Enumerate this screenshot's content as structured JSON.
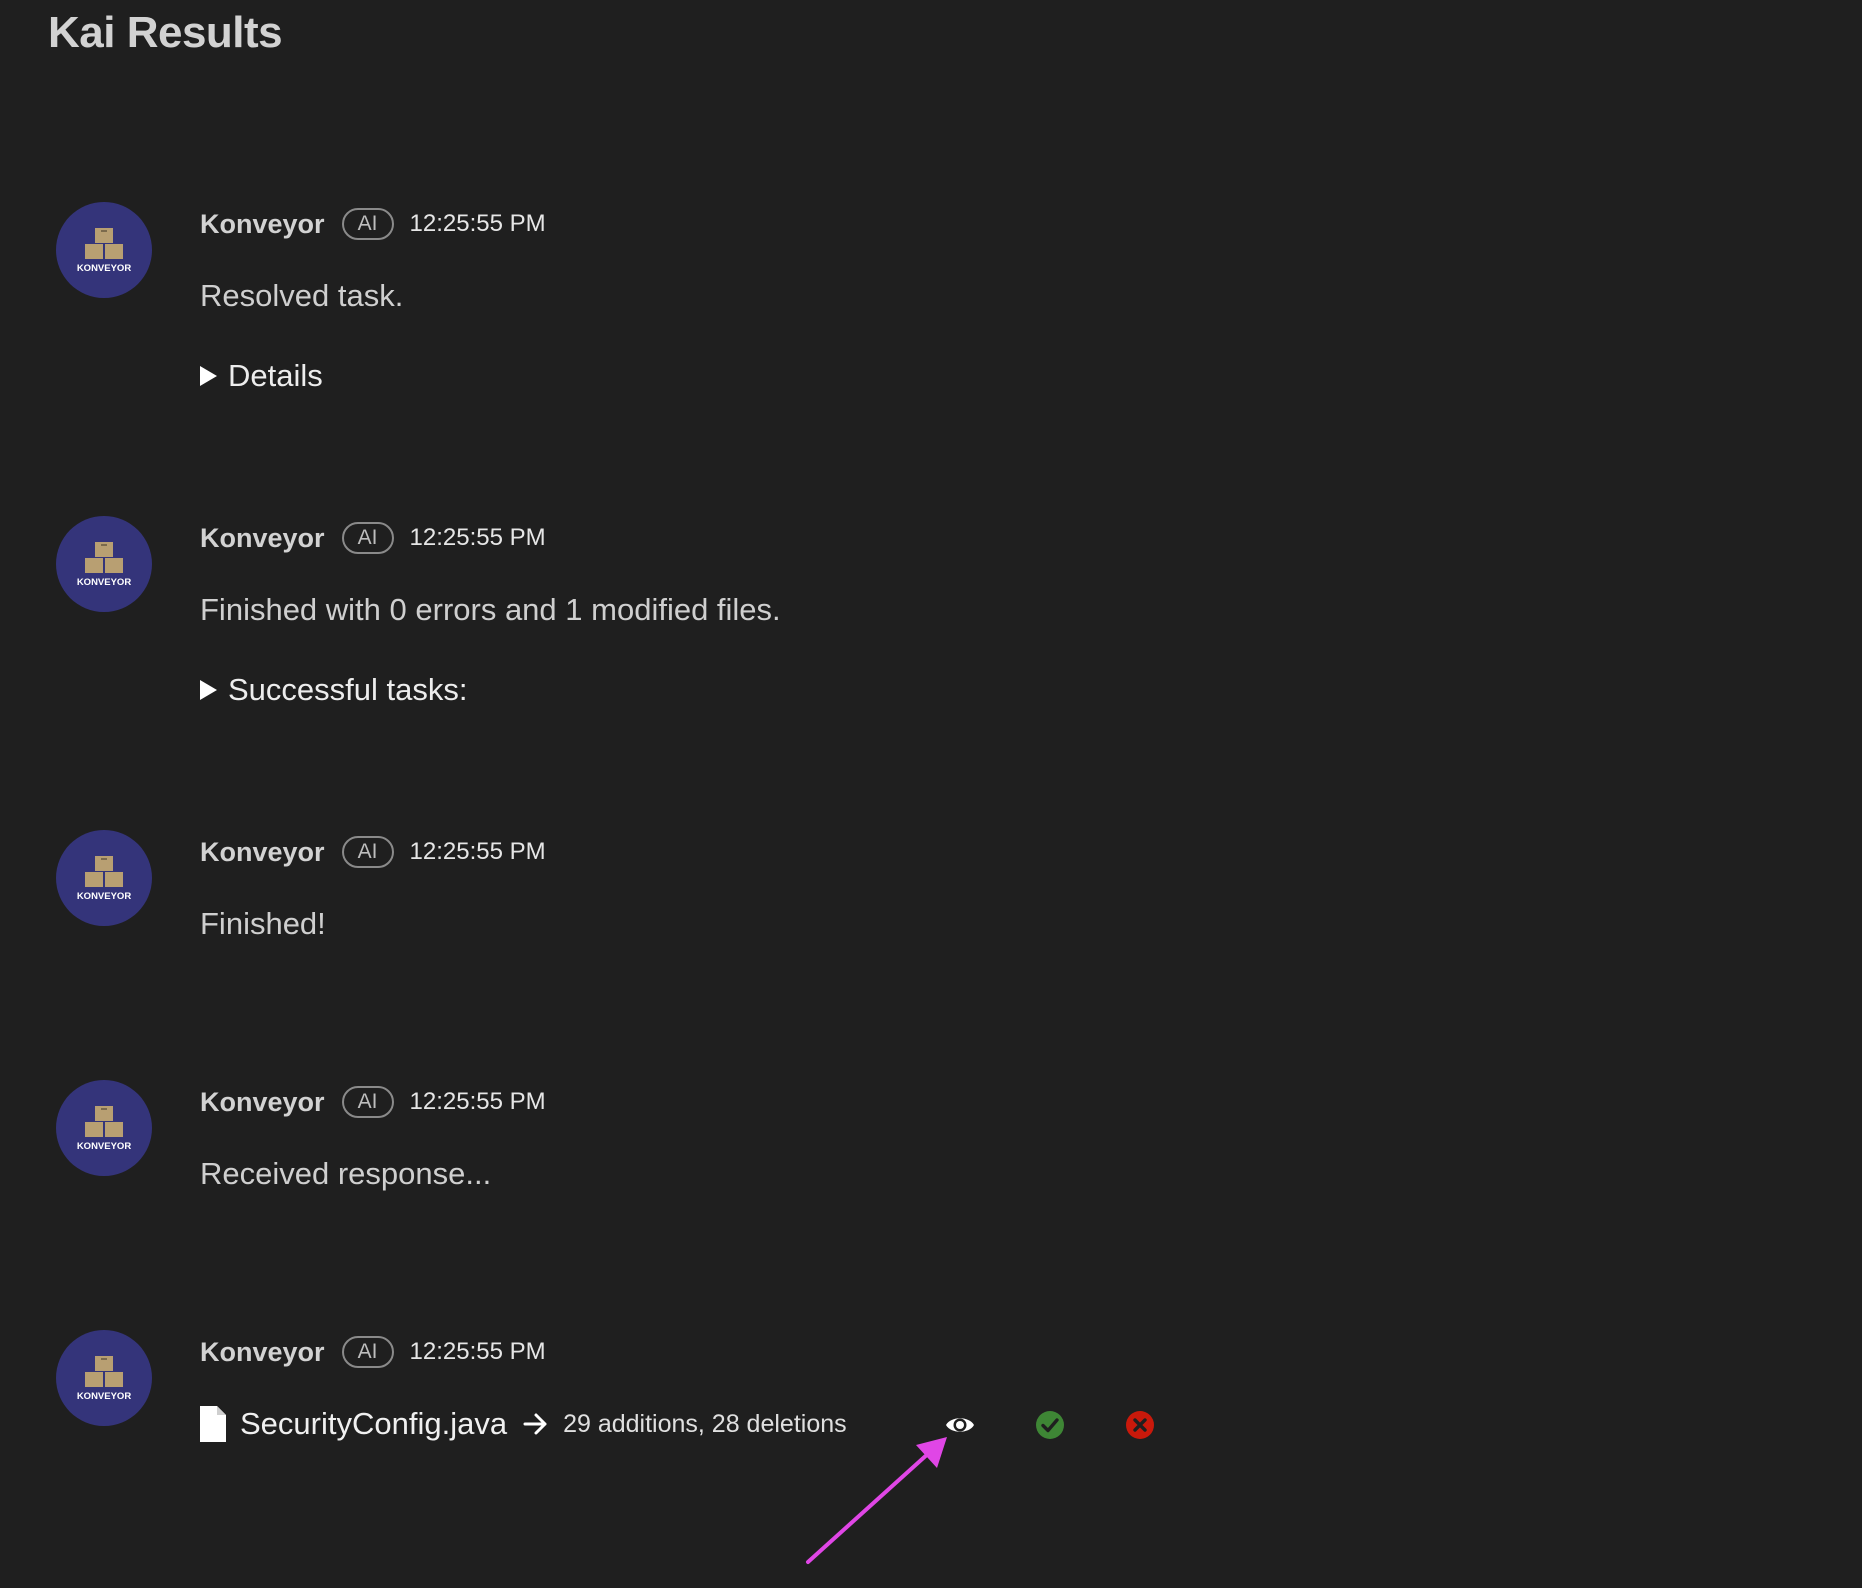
{
  "page": {
    "title": "Kai Results"
  },
  "brand": {
    "avatar_text": "KONVEYOR",
    "avatar_bg": "#34347a",
    "box_color": "#b89f72"
  },
  "messages": [
    {
      "author": "Konveyor",
      "badge": "AI",
      "time": "12:25:55 PM",
      "text": "Resolved task.",
      "disclosure": "Details"
    },
    {
      "author": "Konveyor",
      "badge": "AI",
      "time": "12:25:55 PM",
      "text": "Finished with 0 errors and 1 modified files.",
      "disclosure": "Successful tasks:"
    },
    {
      "author": "Konveyor",
      "badge": "AI",
      "time": "12:25:55 PM",
      "text": "Finished!"
    },
    {
      "author": "Konveyor",
      "badge": "AI",
      "time": "12:25:55 PM",
      "text": "Received response..."
    },
    {
      "author": "Konveyor",
      "badge": "AI",
      "time": "12:25:55 PM",
      "file": {
        "name": "SecurityConfig.java",
        "stats": "29 additions, 28 deletions",
        "actions": [
          {
            "icon": "eye-icon",
            "color": "#ffffff"
          },
          {
            "icon": "check-circle-icon",
            "color": "#3e8635"
          },
          {
            "icon": "close-circle-icon",
            "color": "#c9190b"
          }
        ]
      }
    }
  ],
  "annotation": {
    "color": "#e046e6",
    "icon": "annotation-arrow"
  }
}
